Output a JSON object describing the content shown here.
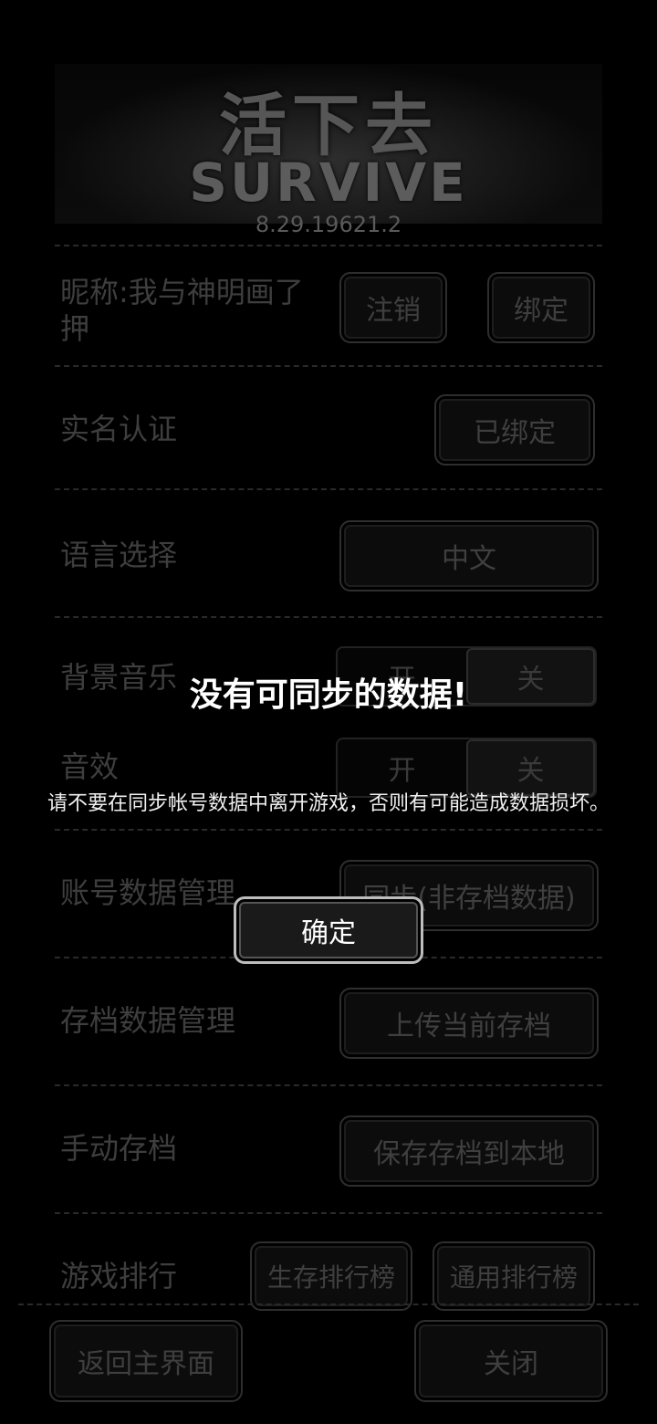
{
  "header": {
    "logo_cn": "活下去",
    "logo_en": "SURVIVE",
    "version": "8.29.19621.2"
  },
  "settings": {
    "nickname": {
      "label": "昵称:我与神明画了押",
      "logout_button": "注销",
      "bind_button": "绑定"
    },
    "real_name": {
      "label": "实名认证",
      "status_button": "已绑定"
    },
    "language": {
      "label": "语言选择",
      "value": "中文"
    },
    "bgm": {
      "label": "背景音乐",
      "on": "开",
      "off": "关",
      "selected": "关"
    },
    "sfx": {
      "label": "音效",
      "on": "开",
      "off": "关",
      "selected": "关"
    },
    "account_data": {
      "label": "账号数据管理",
      "button": "同步(非存档数据)"
    },
    "save_data": {
      "label": "存档数据管理",
      "button": "上传当前存档"
    },
    "manual_save": {
      "label": "手动存档",
      "button": "保存存档到本地"
    },
    "ranking": {
      "label": "游戏排行",
      "survival_button": "生存排行榜",
      "general_button": "通用排行榜"
    }
  },
  "footer": {
    "back_button": "返回主界面",
    "close_button": "关闭"
  },
  "dialog": {
    "title": "没有可同步的数据!",
    "message": "请不要在同步帐号数据中离开游戏，否则有可能造成数据损坏。",
    "confirm_button": "确定"
  }
}
